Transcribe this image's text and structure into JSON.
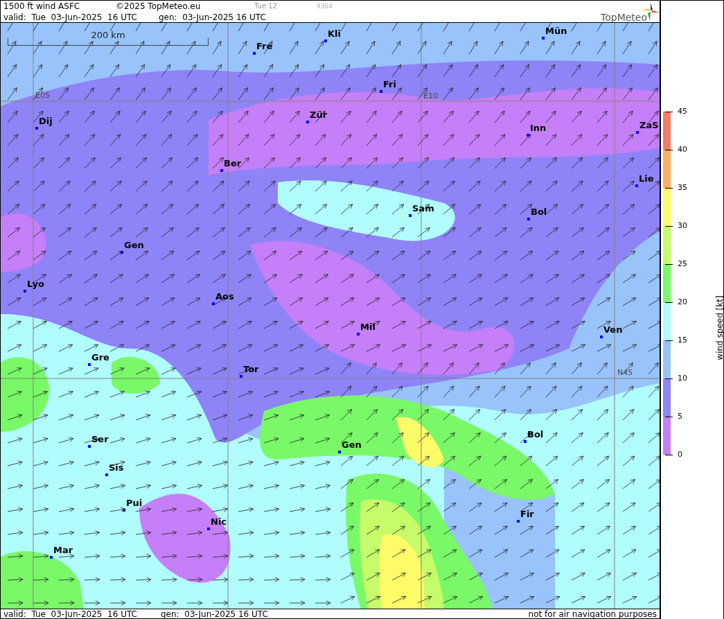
{
  "header": {
    "title": "1500 ft wind ASFC",
    "copyright": "©2025 TopMeteo.eu",
    "step": "Tue 12",
    "code": "9304",
    "valid": "valid:  Tue  03-Jun-2025  16 UTC",
    "generated": "gen:  03-Jun-2025 16 UTC",
    "logo": "TopMeteo"
  },
  "map": {
    "scale": "200 km",
    "grid_labels": [
      "E05",
      "E10",
      "N45"
    ],
    "cities": [
      "Kli",
      "Mün",
      "Fre",
      "Fri",
      "Dij",
      "Zür",
      "Inn",
      "ZaS",
      "Ber",
      "Lie",
      "Sam",
      "Bol",
      "Gen",
      "Lyo",
      "Aos",
      "Mil",
      "Ven",
      "Gre",
      "Tor",
      "Ser",
      "Bol",
      "Gen",
      "Sis",
      "Pui",
      "Nic",
      "Fir",
      "Mar"
    ]
  },
  "legend": {
    "title": "wind speed [kt]",
    "ticks": [
      "45",
      "40",
      "35",
      "30",
      "25",
      "20",
      "15",
      "10",
      "5",
      "0"
    ],
    "bands": [
      {
        "color": "#f27e67"
      },
      {
        "color": "#fdae66"
      },
      {
        "color": "#fcfc69"
      },
      {
        "color": "#c6fb69"
      },
      {
        "color": "#79f868"
      },
      {
        "color": "#b1fcfc"
      },
      {
        "color": "#98c3fb"
      },
      {
        "color": "#8f83f8"
      },
      {
        "color": "#c57ff8"
      }
    ]
  },
  "footer": {
    "valid": "valid:  Tue  03-Jun-2025  16 UTC",
    "generated": "gen:  03-Jun-2025 16 UTC",
    "notice": "not for air navigation purposes"
  }
}
